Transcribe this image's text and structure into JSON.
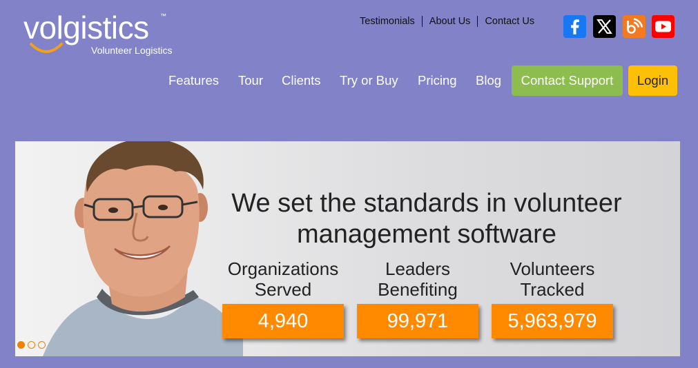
{
  "logo": {
    "word": "volgistics",
    "tm": "™",
    "tagline": "Volunteer Logistics"
  },
  "top_links": [
    "Testimonials",
    "About Us",
    "Contact Us"
  ],
  "social": [
    "facebook-icon",
    "x-icon",
    "blog-icon",
    "youtube-icon"
  ],
  "nav": {
    "items": [
      "Features",
      "Tour",
      "Clients",
      "Try or Buy",
      "Pricing",
      "Blog"
    ],
    "support_label": "Contact Support",
    "login_label": "Login"
  },
  "hero": {
    "headline_line1": "We set the standards in volunteer",
    "headline_line2": "management software",
    "stats": [
      {
        "label1": "Organizations",
        "label2": "Served",
        "value": "4,940"
      },
      {
        "label1": "Leaders",
        "label2": "Benefiting",
        "value": "99,971"
      },
      {
        "label1": "Volunteers",
        "label2": "Tracked",
        "value": "5,963,979"
      }
    ],
    "slides_total": 3,
    "slide_active": 1
  },
  "colors": {
    "background": "#8182c7",
    "support": "#8dbd4e",
    "login": "#fec007",
    "stat": "#ff8a00"
  }
}
